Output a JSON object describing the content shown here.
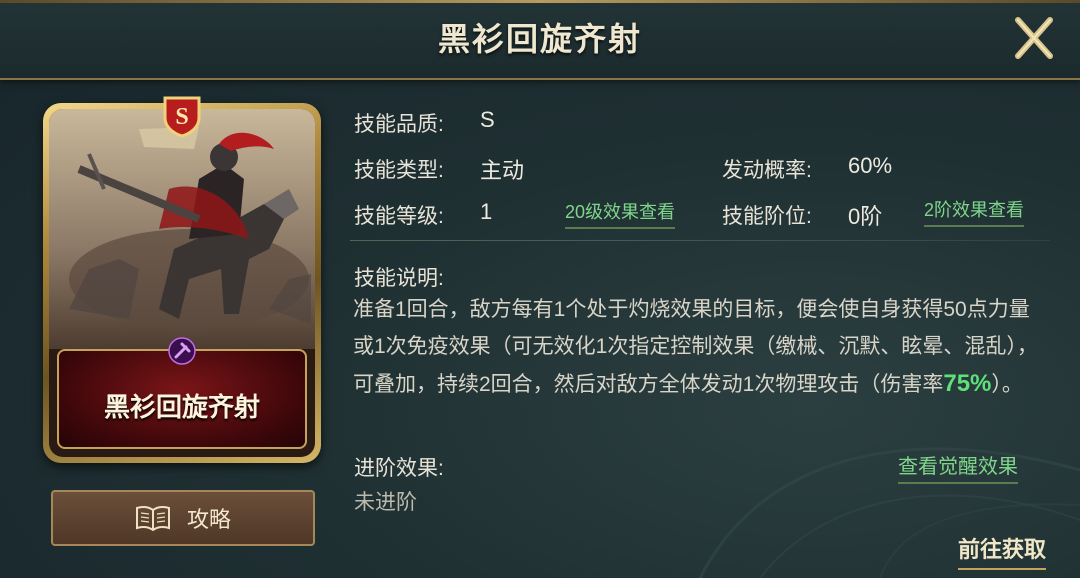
{
  "header": {
    "title": "黑衫回旋齐射"
  },
  "card": {
    "name": "黑衫回旋齐射",
    "grade": "S"
  },
  "guide_button": {
    "label": "攻略"
  },
  "skill": {
    "quality_label": "技能品质:",
    "quality_value": "S",
    "type_label": "技能类型:",
    "type_value": "主动",
    "rate_label": "发动概率:",
    "rate_value": "60%",
    "level_label": "技能等级:",
    "level_value": "1",
    "level20_link": "20级效果查看",
    "stage_label": "技能阶位:",
    "stage_value": "0阶",
    "stage2_link": "2阶效果查看",
    "desc_label": "技能说明:",
    "desc_part1": "准备1回合，敌方每有1个处于灼烧效果的目标，便会使自身获得50点力量或1次免疫效果（可无效化1次指定控制效果（缴械、沉默、眩晕、混乱），可叠加，持续2回合，然后对敌方全体发动1次物理攻击（伤害率",
    "desc_highlight": "75%",
    "desc_part2": "）。",
    "advance_label": "进阶效果:",
    "advance_value": "未进阶",
    "awaken_link": "查看觉醒效果",
    "goto_link": "前往获取"
  },
  "colors": {
    "accent_green": "#5ee07a",
    "gold": "#c7a25a",
    "card_red": "#7a1518"
  }
}
